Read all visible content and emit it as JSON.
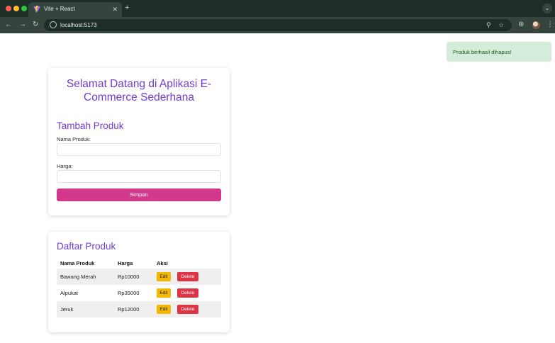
{
  "browser": {
    "tab_title": "Vite + React",
    "url": "localhost:5173"
  },
  "toast": {
    "message": "Produk berhasil dihapus!"
  },
  "app": {
    "title": "Selamat Datang di Aplikasi E-Commerce Sederhana"
  },
  "form": {
    "section_title": "Tambah Produk",
    "name_label": "Nama Produk:",
    "name_value": "",
    "price_label": "Harga:",
    "price_value": "",
    "submit_label": "Simpan"
  },
  "product_list": {
    "section_title": "Daftar Produk",
    "columns": [
      "Nama Produk",
      "Harga",
      "Aksi"
    ],
    "rows": [
      {
        "name": "Bawang Merah",
        "price": "Rp10000",
        "edit": "Edit",
        "delete": "Delete"
      },
      {
        "name": "Alpukat",
        "price": "Rp35000",
        "edit": "Edit",
        "delete": "Delete"
      },
      {
        "name": "Jeruk",
        "price": "Rp12000",
        "edit": "Edit",
        "delete": "Delete"
      }
    ]
  },
  "colors": {
    "accent_purple": "#6f3ccf",
    "submit_pink": "#d3398b",
    "edit_yellow": "#f5b800",
    "delete_red": "#dc3545",
    "toast_bg": "#d4edda"
  }
}
